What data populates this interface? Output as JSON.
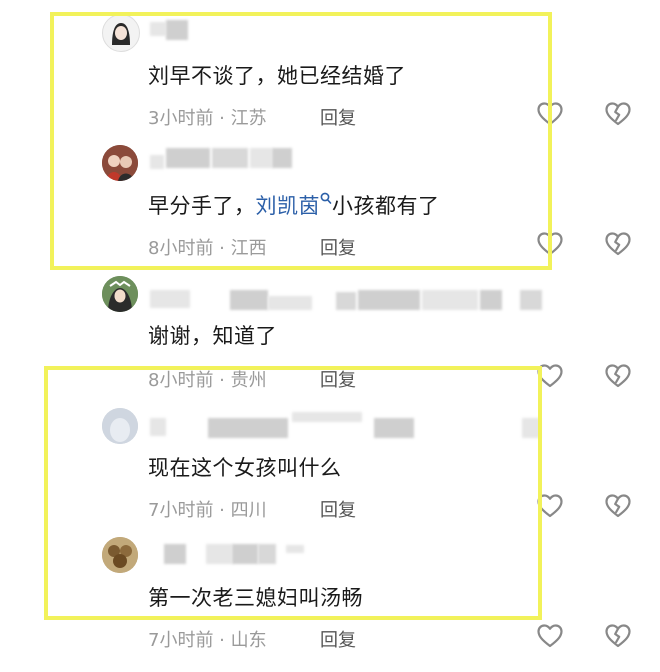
{
  "comments": [
    {
      "text": "刘早不谈了，她已经结婚了",
      "time": "3小时前",
      "location": "江苏",
      "reply": "回复"
    },
    {
      "text_before": "早分手了，",
      "mention": "刘凯茵",
      "text_after": "小孩都有了",
      "time": "8小时前",
      "location": "江西",
      "reply": "回复"
    },
    {
      "text": "谢谢，知道了",
      "time": "8小时前",
      "location": "贵州",
      "reply": "回复"
    },
    {
      "text": "现在这个女孩叫什么",
      "time": "7小时前",
      "location": "四川",
      "reply": "回复"
    },
    {
      "text": "第一次老三媳妇叫汤畅",
      "time": "7小时前",
      "location": "山东",
      "reply": "回复"
    }
  ],
  "separator": " · ",
  "colors": {
    "highlight": "#f2f25a",
    "mention": "#2b5fa8",
    "meta": "#9a9a9a",
    "icon": "#888888"
  },
  "icons": [
    "avatar",
    "like-heart-icon",
    "broken-heart-icon",
    "search-icon"
  ]
}
